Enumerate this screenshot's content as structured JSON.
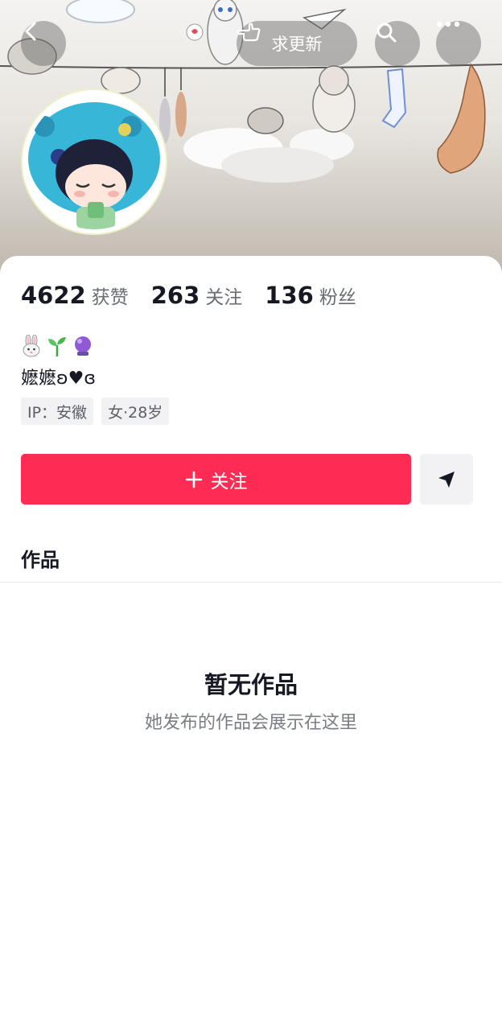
{
  "header": {
    "update_label": "求更新"
  },
  "stats": [
    {
      "value": "4622",
      "label": "获赞"
    },
    {
      "value": "263",
      "label": "关注"
    },
    {
      "value": "136",
      "label": "粉丝"
    }
  ],
  "profile": {
    "bio_emojis": [
      "rabbit-emoji",
      "seedling-emoji",
      "crystal-ball-emoji"
    ],
    "nickname": "嬷嬷ʚ♥ɞ",
    "tags": [
      "IP：安徽",
      "女·28岁"
    ]
  },
  "actions": {
    "follow_label": "关注"
  },
  "works": {
    "section_title": "作品",
    "empty_title": "暂无作品",
    "empty_subtitle": "她发布的作品会展示在这里"
  },
  "colors": {
    "accent": "#fe2c55",
    "text_primary": "#161823",
    "text_secondary": "#6b6d75"
  },
  "icons": [
    "back-icon",
    "pointing-hand-icon",
    "search-icon",
    "more-icon",
    "plus-icon",
    "send-icon"
  ]
}
